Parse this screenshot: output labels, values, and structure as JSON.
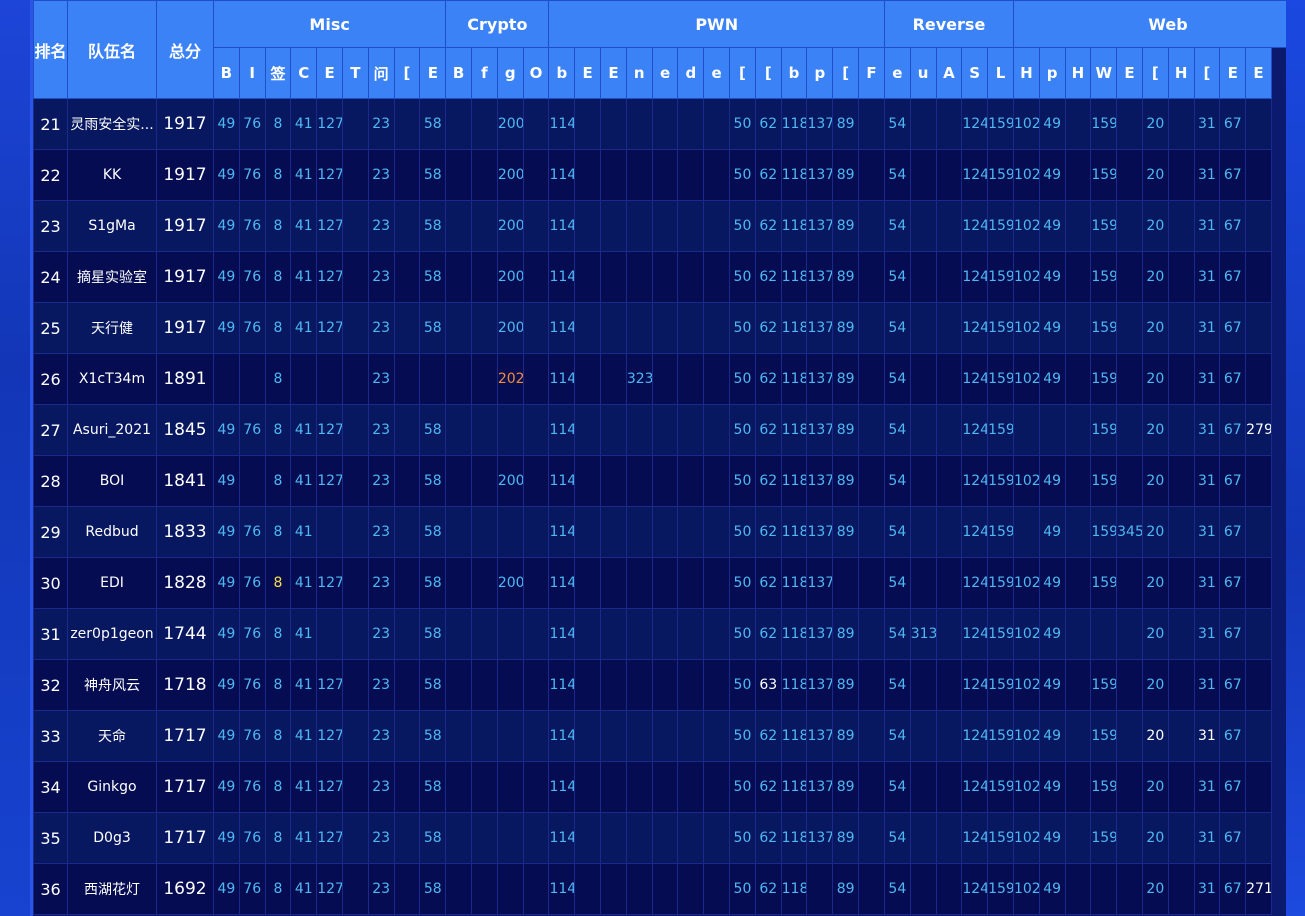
{
  "header": {
    "rank": "排名",
    "team": "队伍名",
    "total": "总分",
    "categories": [
      {
        "name": "Misc",
        "span": 9
      },
      {
        "name": "Crypto",
        "span": 4
      },
      {
        "name": "PWN",
        "span": 13
      },
      {
        "name": "Reverse",
        "span": 5
      },
      {
        "name": "Web",
        "span": 11
      }
    ],
    "challenges": [
      "B",
      "I",
      "签",
      "C",
      "E",
      "T",
      "问",
      "[",
      "E",
      "B",
      "f",
      "g",
      "O",
      "b",
      "E",
      "E",
      "n",
      "e",
      "d",
      "e",
      "[",
      "[",
      "b",
      "p",
      "[",
      "F",
      "e",
      "u",
      "A",
      "S",
      "L",
      "H",
      "p",
      "H",
      "W",
      "E",
      "[",
      "H",
      "[",
      "E",
      "E"
    ]
  },
  "colors": {
    "header": "#3b82f6",
    "solved": "#4fb8f2",
    "first_blood": "#f28c3c",
    "second_blood": "#f5e04a",
    "third_blood": "#ffffff"
  },
  "rows": [
    {
      "rank": "21",
      "team": "灵雨安全实...",
      "total": "1917",
      "scores": [
        "49",
        "76",
        "8",
        "41",
        "127",
        "",
        "23",
        "",
        "58",
        "",
        "",
        "200",
        "",
        "114",
        "",
        "",
        "",
        "",
        "",
        "",
        "50",
        "62",
        "118",
        "137",
        "89",
        "",
        "54",
        "",
        "",
        "124",
        "159",
        "102",
        "49",
        "",
        "159",
        "",
        "20",
        "",
        "31",
        "67",
        ""
      ]
    },
    {
      "rank": "22",
      "team": "KK",
      "total": "1917",
      "scores": [
        "49",
        "76",
        "8",
        "41",
        "127",
        "",
        "23",
        "",
        "58",
        "",
        "",
        "200",
        "",
        "114",
        "",
        "",
        "",
        "",
        "",
        "",
        "50",
        "62",
        "118",
        "137",
        "89",
        "",
        "54",
        "",
        "",
        "124",
        "159",
        "102",
        "49",
        "",
        "159",
        "",
        "20",
        "",
        "31",
        "67",
        ""
      ]
    },
    {
      "rank": "23",
      "team": "S1gMa",
      "total": "1917",
      "scores": [
        "49",
        "76",
        "8",
        "41",
        "127",
        "",
        "23",
        "",
        "58",
        "",
        "",
        "200",
        "",
        "114",
        "",
        "",
        "",
        "",
        "",
        "",
        "50",
        "62",
        "118",
        "137",
        "89",
        "",
        "54",
        "",
        "",
        "124",
        "159",
        "102",
        "49",
        "",
        "159",
        "",
        "20",
        "",
        "31",
        "67",
        ""
      ]
    },
    {
      "rank": "24",
      "team": "摘星实验室",
      "total": "1917",
      "scores": [
        "49",
        "76",
        "8",
        "41",
        "127",
        "",
        "23",
        "",
        "58",
        "",
        "",
        "200",
        "",
        "114",
        "",
        "",
        "",
        "",
        "",
        "",
        "50",
        "62",
        "118",
        "137",
        "89",
        "",
        "54",
        "",
        "",
        "124",
        "159",
        "102",
        "49",
        "",
        "159",
        "",
        "20",
        "",
        "31",
        "67",
        ""
      ]
    },
    {
      "rank": "25",
      "team": "天行健",
      "total": "1917",
      "scores": [
        "49",
        "76",
        "8",
        "41",
        "127",
        "",
        "23",
        "",
        "58",
        "",
        "",
        "200",
        "",
        "114",
        "",
        "",
        "",
        "",
        "",
        "",
        "50",
        "62",
        "118",
        "137",
        "89",
        "",
        "54",
        "",
        "",
        "124",
        "159",
        "102",
        "49",
        "",
        "159",
        "",
        "20",
        "",
        "31",
        "67",
        ""
      ]
    },
    {
      "rank": "26",
      "team": "X1cT34m",
      "total": "1891",
      "scores": [
        "",
        "",
        "8",
        "",
        "",
        "",
        "23",
        "",
        "",
        "",
        "",
        "202",
        "",
        "114",
        "",
        "",
        "323",
        "",
        "",
        "",
        "50",
        "62",
        "118",
        "137",
        "89",
        "",
        "54",
        "",
        "",
        "124",
        "159",
        "102",
        "49",
        "",
        "159",
        "",
        "20",
        "",
        "31",
        "67",
        ""
      ],
      "highlights": {
        "11": "orange"
      }
    },
    {
      "rank": "27",
      "team": "Asuri_2021",
      "total": "1845",
      "scores": [
        "49",
        "76",
        "8",
        "41",
        "127",
        "",
        "23",
        "",
        "58",
        "",
        "",
        "",
        "",
        "114",
        "",
        "",
        "",
        "",
        "",
        "",
        "50",
        "62",
        "118",
        "137",
        "89",
        "",
        "54",
        "",
        "",
        "124",
        "159",
        "",
        "",
        "",
        "159",
        "",
        "20",
        "",
        "31",
        "67",
        "279"
      ],
      "highlights": {
        "40": "white"
      }
    },
    {
      "rank": "28",
      "team": "BOI",
      "total": "1841",
      "scores": [
        "49",
        "",
        "8",
        "41",
        "127",
        "",
        "23",
        "",
        "58",
        "",
        "",
        "200",
        "",
        "114",
        "",
        "",
        "",
        "",
        "",
        "",
        "50",
        "62",
        "118",
        "137",
        "89",
        "",
        "54",
        "",
        "",
        "124",
        "159",
        "102",
        "49",
        "",
        "159",
        "",
        "20",
        "",
        "31",
        "67",
        ""
      ]
    },
    {
      "rank": "29",
      "team": "Redbud",
      "total": "1833",
      "scores": [
        "49",
        "76",
        "8",
        "41",
        "",
        "",
        "23",
        "",
        "58",
        "",
        "",
        "",
        "",
        "114",
        "",
        "",
        "",
        "",
        "",
        "",
        "50",
        "62",
        "118",
        "137",
        "89",
        "",
        "54",
        "",
        "",
        "124",
        "159",
        "",
        "49",
        "",
        "159",
        "345",
        "20",
        "",
        "31",
        "67",
        ""
      ]
    },
    {
      "rank": "30",
      "team": "EDI",
      "total": "1828",
      "scores": [
        "49",
        "76",
        "8",
        "41",
        "127",
        "",
        "23",
        "",
        "58",
        "",
        "",
        "200",
        "",
        "114",
        "",
        "",
        "",
        "",
        "",
        "",
        "50",
        "62",
        "118",
        "137",
        "",
        "",
        "54",
        "",
        "",
        "124",
        "159",
        "102",
        "49",
        "",
        "159",
        "",
        "20",
        "",
        "31",
        "67",
        ""
      ],
      "highlights": {
        "2": "yellow"
      }
    },
    {
      "rank": "31",
      "team": "zer0p1geon",
      "total": "1744",
      "scores": [
        "49",
        "76",
        "8",
        "41",
        "",
        "",
        "23",
        "",
        "58",
        "",
        "",
        "",
        "",
        "114",
        "",
        "",
        "",
        "",
        "",
        "",
        "50",
        "62",
        "118",
        "137",
        "89",
        "",
        "54",
        "313",
        "",
        "124",
        "159",
        "102",
        "49",
        "",
        "",
        "",
        "20",
        "",
        "31",
        "67",
        ""
      ]
    },
    {
      "rank": "32",
      "team": "神舟风云",
      "total": "1718",
      "scores": [
        "49",
        "76",
        "8",
        "41",
        "127",
        "",
        "23",
        "",
        "58",
        "",
        "",
        "",
        "",
        "114",
        "",
        "",
        "",
        "",
        "",
        "",
        "50",
        "63",
        "118",
        "137",
        "89",
        "",
        "54",
        "",
        "",
        "124",
        "159",
        "102",
        "49",
        "",
        "159",
        "",
        "20",
        "",
        "31",
        "67",
        ""
      ],
      "highlights": {
        "21": "white"
      }
    },
    {
      "rank": "33",
      "team": "天命",
      "total": "1717",
      "scores": [
        "49",
        "76",
        "8",
        "41",
        "127",
        "",
        "23",
        "",
        "58",
        "",
        "",
        "",
        "",
        "114",
        "",
        "",
        "",
        "",
        "",
        "",
        "50",
        "62",
        "118",
        "137",
        "89",
        "",
        "54",
        "",
        "",
        "124",
        "159",
        "102",
        "49",
        "",
        "159",
        "",
        "20",
        "",
        "31",
        "67",
        ""
      ],
      "highlights": {
        "36": "white",
        "38": "white"
      }
    },
    {
      "rank": "34",
      "team": "Ginkgo",
      "total": "1717",
      "scores": [
        "49",
        "76",
        "8",
        "41",
        "127",
        "",
        "23",
        "",
        "58",
        "",
        "",
        "",
        "",
        "114",
        "",
        "",
        "",
        "",
        "",
        "",
        "50",
        "62",
        "118",
        "137",
        "89",
        "",
        "54",
        "",
        "",
        "124",
        "159",
        "102",
        "49",
        "",
        "159",
        "",
        "20",
        "",
        "31",
        "67",
        ""
      ]
    },
    {
      "rank": "35",
      "team": "D0g3",
      "total": "1717",
      "scores": [
        "49",
        "76",
        "8",
        "41",
        "127",
        "",
        "23",
        "",
        "58",
        "",
        "",
        "",
        "",
        "114",
        "",
        "",
        "",
        "",
        "",
        "",
        "50",
        "62",
        "118",
        "137",
        "89",
        "",
        "54",
        "",
        "",
        "124",
        "159",
        "102",
        "49",
        "",
        "159",
        "",
        "20",
        "",
        "31",
        "67",
        ""
      ]
    },
    {
      "rank": "36",
      "team": "西湖花灯",
      "total": "1692",
      "scores": [
        "49",
        "76",
        "8",
        "41",
        "127",
        "",
        "23",
        "",
        "58",
        "",
        "",
        "",
        "",
        "114",
        "",
        "",
        "",
        "",
        "",
        "",
        "50",
        "62",
        "118",
        "",
        "89",
        "",
        "54",
        "",
        "",
        "124",
        "159",
        "102",
        "49",
        "",
        "",
        "",
        "20",
        "",
        "31",
        "67",
        "271"
      ],
      "highlights": {
        "40": "white"
      }
    }
  ]
}
